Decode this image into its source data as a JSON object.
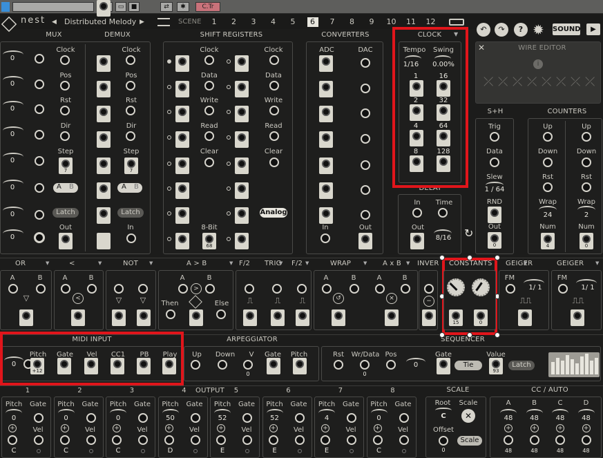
{
  "host": {
    "ctr_label": "C.Tr"
  },
  "topbar": {
    "logo": "nest",
    "preset_name": "Distributed Melody",
    "scene_label": "SCENE",
    "scenes": [
      "1",
      "2",
      "3",
      "4",
      "5",
      "6",
      "7",
      "8",
      "9",
      "10",
      "11",
      "12"
    ],
    "selected_scene": "6",
    "sound_label": "SOUND"
  },
  "mux": {
    "title": "MUX",
    "labels": [
      "Clock",
      "Pos",
      "Rst",
      "Dir",
      "Step",
      "",
      "Latch",
      "Out"
    ],
    "values": [
      "0",
      "0",
      "0",
      "0",
      "0",
      "0",
      "0",
      "0"
    ],
    "step_value": "7",
    "ab_a": "A",
    "ab_b": "B",
    "latch": "Latch"
  },
  "demux": {
    "title": "DEMUX",
    "labels": [
      "Clock",
      "Pos",
      "Rst",
      "Dir",
      "Step",
      "",
      "Latch",
      "In"
    ],
    "step_value": "7"
  },
  "shift": {
    "title": "SHIFT REGISTERS",
    "labels": [
      "Clock",
      "Data",
      "Write",
      "Read",
      "Clear",
      "8-Bit"
    ],
    "value68": "68",
    "analog": "Analog",
    "right_labels": [
      "Clock",
      "Data",
      "Write",
      "Read",
      "Clear"
    ]
  },
  "converters": {
    "title": "CONVERTERS",
    "adc": "ADC",
    "dac": "DAC",
    "in": "In",
    "out": "Out"
  },
  "clock": {
    "title": "CLOCK",
    "tempo": "Tempo",
    "swing": "Swing",
    "tempo_val": "1/16",
    "swing_val": "0.00%",
    "divs": [
      "1",
      "16",
      "2",
      "32",
      "4",
      "64",
      "8",
      "128"
    ]
  },
  "wire_editor": {
    "title": "WIRE EDITOR"
  },
  "delay": {
    "title": "DELAY",
    "in": "In",
    "time": "Time",
    "out": "Out",
    "time_val": "8/16"
  },
  "sh": {
    "title": "S+H",
    "trig": "Trig",
    "data": "Data",
    "slew": "Slew",
    "slew_val": "1 / 64",
    "rnd": "RND",
    "out": "Out"
  },
  "counters": {
    "title": "COUNTERS",
    "up": "Up",
    "down": "Down",
    "rst": "Rst",
    "wrap": "Wrap",
    "num": "Num",
    "wrap1": "24",
    "wrap2": "2",
    "num1": "4",
    "num2": "0"
  },
  "row2": {
    "or": "OR",
    "lt": "<",
    "not": "NOT",
    "agtb": "A > B",
    "f2a": "F/2",
    "trig": "TRIG",
    "f2b": "F/2",
    "wrap": "WRAP",
    "axb": "A x B",
    "inver": "INVER",
    "constants": "CONSTANTS",
    "geiger1": "GEIGER",
    "geiger2": "GEIGER",
    "a": "A",
    "b": "B",
    "then": "Then",
    "else": "Else",
    "fm": "FM",
    "ratio": "1/ 1",
    "const_vals": [
      "15",
      "0"
    ]
  },
  "midi": {
    "title": "MIDI INPUT",
    "labels": [
      "Pitch",
      "Gate",
      "Vel",
      "CC1",
      "PB",
      "Play"
    ],
    "pitch_val": "+12",
    "knob_val": "0"
  },
  "arp": {
    "title": "ARPEGGIATOR",
    "labels": [
      "Up",
      "Down",
      "V",
      "Gate",
      "Pitch"
    ],
    "v_val": "0"
  },
  "seq": {
    "title": "SEQUENCER",
    "rst": "Rst",
    "wrdata": "Wr/Data",
    "pos": "Pos",
    "gate": "Gate",
    "value": "Value",
    "tie": "Tie",
    "latch": "Latch",
    "wr_val": "0",
    "pos_val": "0",
    "value_val": "93"
  },
  "output": {
    "title": "OUTPUT",
    "nums": [
      "1",
      "2",
      "3",
      "4",
      "5",
      "6",
      "7",
      "8"
    ],
    "channels": [
      {
        "pv": "0",
        "note": "C"
      },
      {
        "pv": "0",
        "note": "C"
      },
      {
        "pv": "0",
        "note": "C"
      },
      {
        "pv": "50",
        "note": "D"
      },
      {
        "pv": "52",
        "note": "E"
      },
      {
        "pv": "52",
        "note": "E"
      },
      {
        "pv": "4",
        "note": "E"
      },
      {
        "pv": "0",
        "note": "C"
      }
    ],
    "pitch": "Pitch",
    "gate": "Gate",
    "vel": "Vel"
  },
  "scale": {
    "title": "SCALE",
    "root": "Root",
    "scale": "Scale",
    "root_val": "C",
    "offset": "Offset",
    "offset_val": "0",
    "scale_btn": "Scale"
  },
  "ccauto": {
    "title": "CC / AUTO",
    "names": [
      "A",
      "B",
      "C",
      "D"
    ],
    "vals": [
      "48",
      "48",
      "48",
      "48"
    ]
  }
}
